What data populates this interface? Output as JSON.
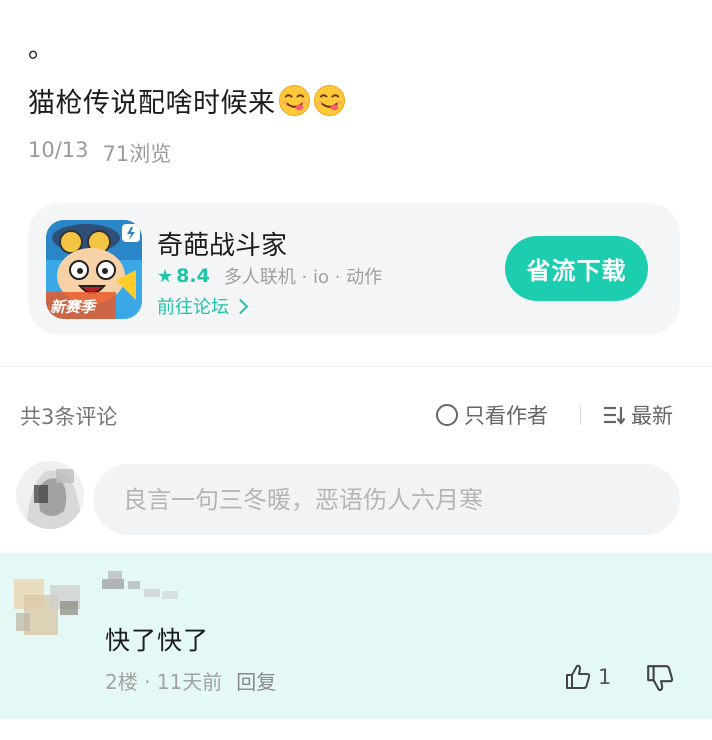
{
  "post": {
    "leading_dot": "。",
    "text": "猫枪传说配啥时候来",
    "emojis": [
      "yum-face-icon",
      "yum-face-icon"
    ],
    "date": "10/13",
    "views": "71浏览"
  },
  "game_card": {
    "name": "奇葩战斗家",
    "rating": "8.4",
    "tags": "多人联机 · io · 动作",
    "forum_link": "前往论坛",
    "download_label": "省流下载",
    "icon_badge_text": "新赛季",
    "accent_color": "#1dc6a6"
  },
  "comments_header": {
    "count_label": "共3条评论",
    "author_only_label": "只看作者",
    "sort_label": "最新"
  },
  "comment_input": {
    "placeholder": "良言一句三冬暖，恶语伤人六月寒"
  },
  "comment": {
    "content": "快了快了",
    "floor_time": "2楼 · 11天前",
    "reply_label": "回复",
    "likes": "1",
    "highlight_color": "#e4f8f5"
  }
}
